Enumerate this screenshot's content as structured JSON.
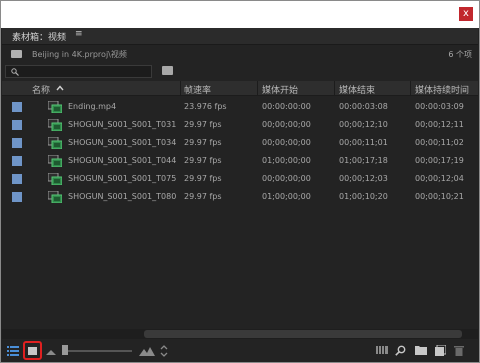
{
  "window": {
    "close_label": "x"
  },
  "panel": {
    "title": "素材箱：视频",
    "menu_icon": "hamburger-menu-icon",
    "menu_glyph": "≡"
  },
  "pathbar": {
    "path": "Beijing in 4K.prproj\\视频",
    "item_count": "6 个项"
  },
  "search": {
    "placeholder": "",
    "value": ""
  },
  "table": {
    "headers": {
      "name": "名称",
      "fps": "帧速率",
      "start": "媒体开始",
      "end": "媒体结束",
      "duration": "媒体持续时间"
    },
    "sort_indicator": "^",
    "rows": [
      {
        "name": "Ending.mp4",
        "fps": "23.976 fps",
        "start": "00:00:00:00",
        "end": "00:00:03:08",
        "duration": "00:00:03:09",
        "label_color": "#6f95c8"
      },
      {
        "name": "SHOGUN_S001_S001_T031",
        "fps": "29.97 fps",
        "start": "00;00;00;00",
        "end": "00;00;12;10",
        "duration": "00;00;12;11",
        "label_color": "#6f95c8"
      },
      {
        "name": "SHOGUN_S001_S001_T034",
        "fps": "29.97 fps",
        "start": "00;00;00;00",
        "end": "00;00;11;01",
        "duration": "00;00;11;02",
        "label_color": "#6f95c8"
      },
      {
        "name": "SHOGUN_S001_S001_T044",
        "fps": "29.97 fps",
        "start": "01;00;00;00",
        "end": "01;00;17;18",
        "duration": "00;00;17;19",
        "label_color": "#6f95c8"
      },
      {
        "name": "SHOGUN_S001_S001_T075",
        "fps": "29.97 fps",
        "start": "00;00;00;00",
        "end": "00;00;12;03",
        "duration": "00;00;12;04",
        "label_color": "#6f95c8"
      },
      {
        "name": "SHOGUN_S001_S001_T080",
        "fps": "29.97 fps",
        "start": "01;00;00;00",
        "end": "01;00;10;20",
        "duration": "00;00;10;21",
        "label_color": "#6f95c8"
      }
    ]
  },
  "bottombar": {
    "zoom_level": 0,
    "icons": [
      "list-view-icon",
      "icon-view-icon",
      "zoom-out-icon",
      "zoom-slider",
      "zoom-in-icon",
      "sort-icon",
      "automate-to-sequence-icon",
      "find-icon",
      "new-bin-icon",
      "new-item-icon",
      "clear-icon"
    ]
  },
  "colors": {
    "panel_bg": "#232323",
    "header_bg": "#2e2e2e",
    "label_blue": "#6f95c8",
    "close_red": "#c1272d",
    "highlight_red": "#e02020"
  }
}
